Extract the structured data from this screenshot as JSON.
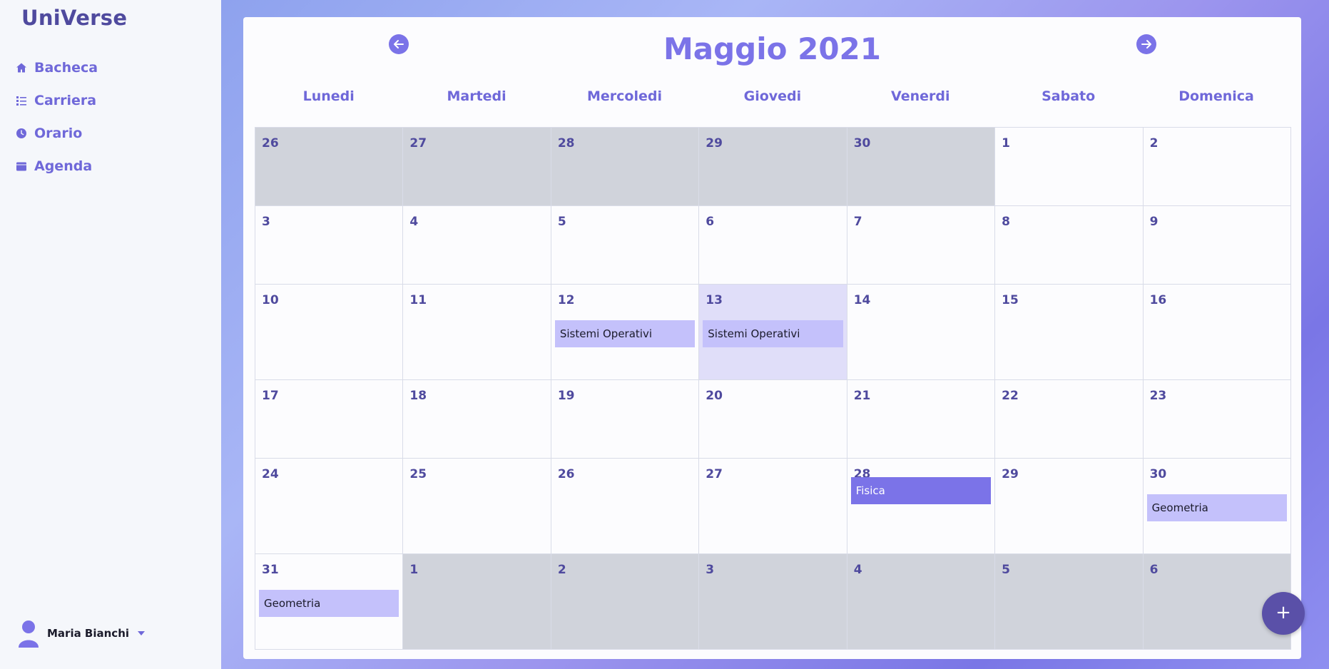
{
  "app": {
    "brand": "UniVerse"
  },
  "sidebar": {
    "items": [
      {
        "label": "Bacheca",
        "icon": "home-icon"
      },
      {
        "label": "Carriera",
        "icon": "list-icon"
      },
      {
        "label": "Orario",
        "icon": "clock-icon"
      },
      {
        "label": "Agenda",
        "icon": "calendar-icon"
      }
    ]
  },
  "user": {
    "name": "Maria Bianchi",
    "icon": "user-icon"
  },
  "calendar": {
    "title": "Maggio 2021",
    "prev_icon": "arrow-left-icon",
    "next_icon": "arrow-right-icon",
    "weekdays": [
      "Lunedi",
      "Martedi",
      "Mercoledi",
      "Giovedi",
      "Venerdi",
      "Sabato",
      "Domenica"
    ],
    "days": [
      {
        "n": "26",
        "other": true
      },
      {
        "n": "27",
        "other": true
      },
      {
        "n": "28",
        "other": true
      },
      {
        "n": "29",
        "other": true
      },
      {
        "n": "30",
        "other": true
      },
      {
        "n": "1"
      },
      {
        "n": "2"
      },
      {
        "n": "3"
      },
      {
        "n": "4"
      },
      {
        "n": "5"
      },
      {
        "n": "6"
      },
      {
        "n": "7"
      },
      {
        "n": "8"
      },
      {
        "n": "9"
      },
      {
        "n": "10"
      },
      {
        "n": "11"
      },
      {
        "n": "12",
        "events": [
          {
            "label": "Sistemi Operativi",
            "style": "light"
          }
        ]
      },
      {
        "n": "13",
        "today": true,
        "events": [
          {
            "label": "Sistemi Operativi",
            "style": "light"
          }
        ]
      },
      {
        "n": "14"
      },
      {
        "n": "15"
      },
      {
        "n": "16"
      },
      {
        "n": "17"
      },
      {
        "n": "18"
      },
      {
        "n": "19"
      },
      {
        "n": "20"
      },
      {
        "n": "21"
      },
      {
        "n": "22"
      },
      {
        "n": "23"
      },
      {
        "n": "24"
      },
      {
        "n": "25"
      },
      {
        "n": "26"
      },
      {
        "n": "27"
      },
      {
        "n": "28",
        "events": [
          {
            "label": "Fisica",
            "style": "dark"
          }
        ]
      },
      {
        "n": "29"
      },
      {
        "n": "30",
        "events": [
          {
            "label": "Geometria",
            "style": "light"
          }
        ]
      },
      {
        "n": "31",
        "events": [
          {
            "label": "Geometria",
            "style": "light"
          }
        ]
      },
      {
        "n": "1",
        "other": true
      },
      {
        "n": "2",
        "other": true
      },
      {
        "n": "3",
        "other": true
      },
      {
        "n": "4",
        "other": true
      },
      {
        "n": "5",
        "other": true
      },
      {
        "n": "6",
        "other": true
      }
    ]
  },
  "fab": {
    "label": "+"
  },
  "colors": {
    "accent": "#7b73e8",
    "dark_accent": "#4f4a9e",
    "other_month": "#d0d3db",
    "today": "#e0def9"
  }
}
